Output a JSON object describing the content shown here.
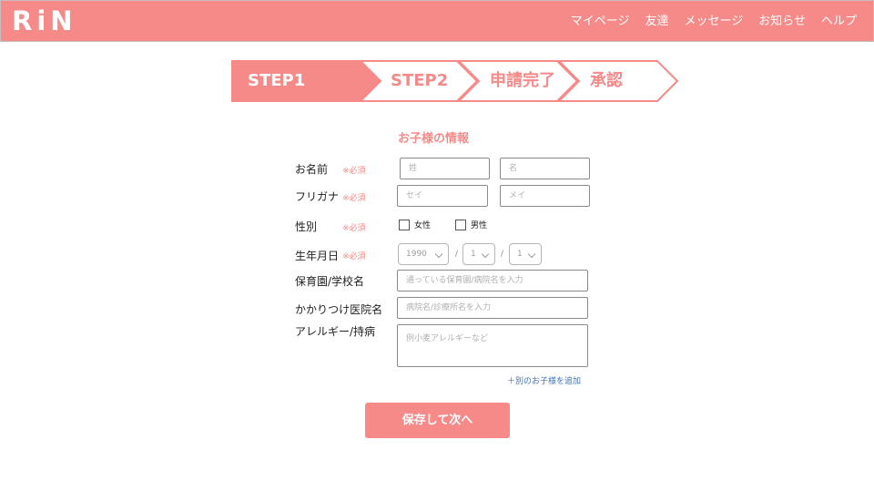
{
  "header": {
    "logo": "RiN",
    "nav": [
      "マイページ",
      "友達",
      "メッセージ",
      "お知らせ",
      "ヘルプ"
    ]
  },
  "steps": [
    "STEP1",
    "STEP2",
    "申請完了",
    "承認"
  ],
  "form": {
    "title": "お子様の情報",
    "required_mark": "※必須",
    "name": {
      "label": "お名前",
      "last_placeholder": "姓",
      "first_placeholder": "名"
    },
    "furigana": {
      "label": "フリガナ",
      "last_placeholder": "セイ",
      "first_placeholder": "メイ"
    },
    "gender": {
      "label": "性別",
      "female": "女性",
      "male": "男性"
    },
    "birthday": {
      "label": "生年月日",
      "year": "1990",
      "month": "1",
      "day": "1",
      "separator": "/"
    },
    "school": {
      "label": "保育園/学校名",
      "placeholder": "通っている保育園/病院名を入力"
    },
    "clinic": {
      "label": "かかりつけ医院名",
      "placeholder": "病院名/診療所名を入力"
    },
    "allergy": {
      "label": "アレルギー/持病",
      "placeholder": "例小麦アレルギーなど"
    },
    "add_child": "＋別のお子様を追加",
    "submit": "保存して次へ"
  },
  "colors": {
    "accent": "#f58a89",
    "link": "#3b74b5"
  }
}
